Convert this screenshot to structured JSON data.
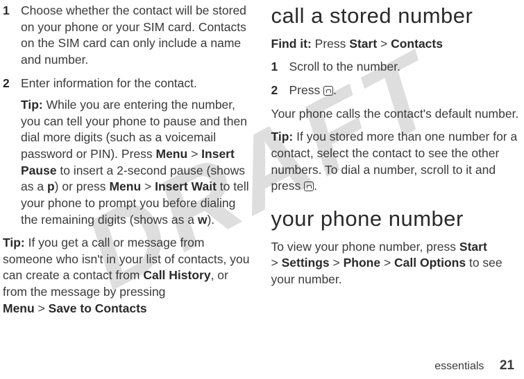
{
  "watermark": "DRAFT",
  "left": {
    "item1": {
      "num": "1",
      "text": "Choose whether the contact will be stored on your phone or your SIM card. Contacts on the SIM card can only include a name and number."
    },
    "item2": {
      "num": "2",
      "lead": "Enter information for the contact.",
      "tip_label": "Tip:",
      "tip_a": " While you are entering the number, you can tell your phone to pause and then dial more digits (such as a voicemail password or PIN). Press ",
      "menu1": "Menu",
      "gt1": " > ",
      "insert_pause": "Insert Pause",
      "tip_b": " to insert a 2-second pause (shows as a ",
      "p_char": "p",
      "tip_c": ") or press ",
      "menu2": "Menu",
      "gt2": " > ",
      "insert_wait": "Insert Wait",
      "tip_d": " to tell your phone to prompt you before dialing the remaining digits (shows as a ",
      "w_char": "w",
      "tip_e": ")."
    },
    "tip2": {
      "label": "Tip:",
      "a": " If you get a call or message from someone who isn't in your list of contacts, you can create a contact from ",
      "call_history": "Call History",
      "b": ", or from the message by pressing ",
      "menu": "Menu",
      "gt": " > ",
      "save": "Save to Contacts"
    }
  },
  "right": {
    "h_call": "call a stored number",
    "find": {
      "label": "Find it:",
      "a": " Press ",
      "start": "Start",
      "gt": " > ",
      "contacts": "Contacts"
    },
    "step1": {
      "num": "1",
      "text": "Scroll to the number."
    },
    "step2": {
      "num": "2",
      "a": "Press ",
      "b": "."
    },
    "default_line": "Your phone calls the contact's default number.",
    "tip": {
      "label": "Tip:",
      "a": " If you stored more than one number for a contact, select the contact to see the other numbers. To dial a number, scroll to it and press ",
      "b": "."
    },
    "h_your": "your phone number",
    "view": {
      "a": "To view your phone number, press ",
      "start": "Start",
      "gt1": " > ",
      "settings": "Settings",
      "gt2": " > ",
      "phone": "Phone",
      "gt3": " > ",
      "callopt": "Call Options",
      "b": " to see your number."
    }
  },
  "footer": {
    "section": "essentials",
    "page": "21"
  }
}
